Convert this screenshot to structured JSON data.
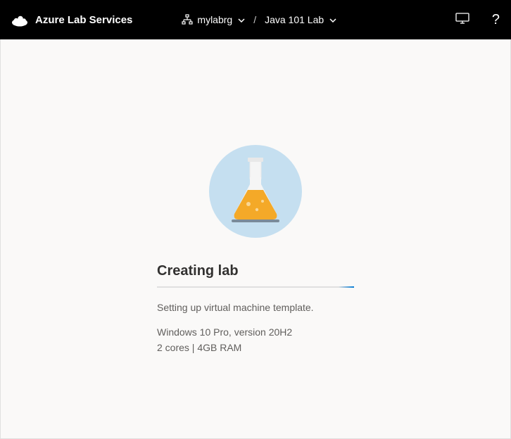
{
  "header": {
    "service_name": "Azure Lab Services",
    "breadcrumb": {
      "resource_group": "mylabrg",
      "lab_name": "Java 101 Lab"
    }
  },
  "main": {
    "status_title": "Creating lab",
    "status_message": "Setting up virtual machine template.",
    "vm_os": "Windows 10 Pro, version 20H2",
    "vm_specs": "2 cores | 4GB RAM"
  }
}
